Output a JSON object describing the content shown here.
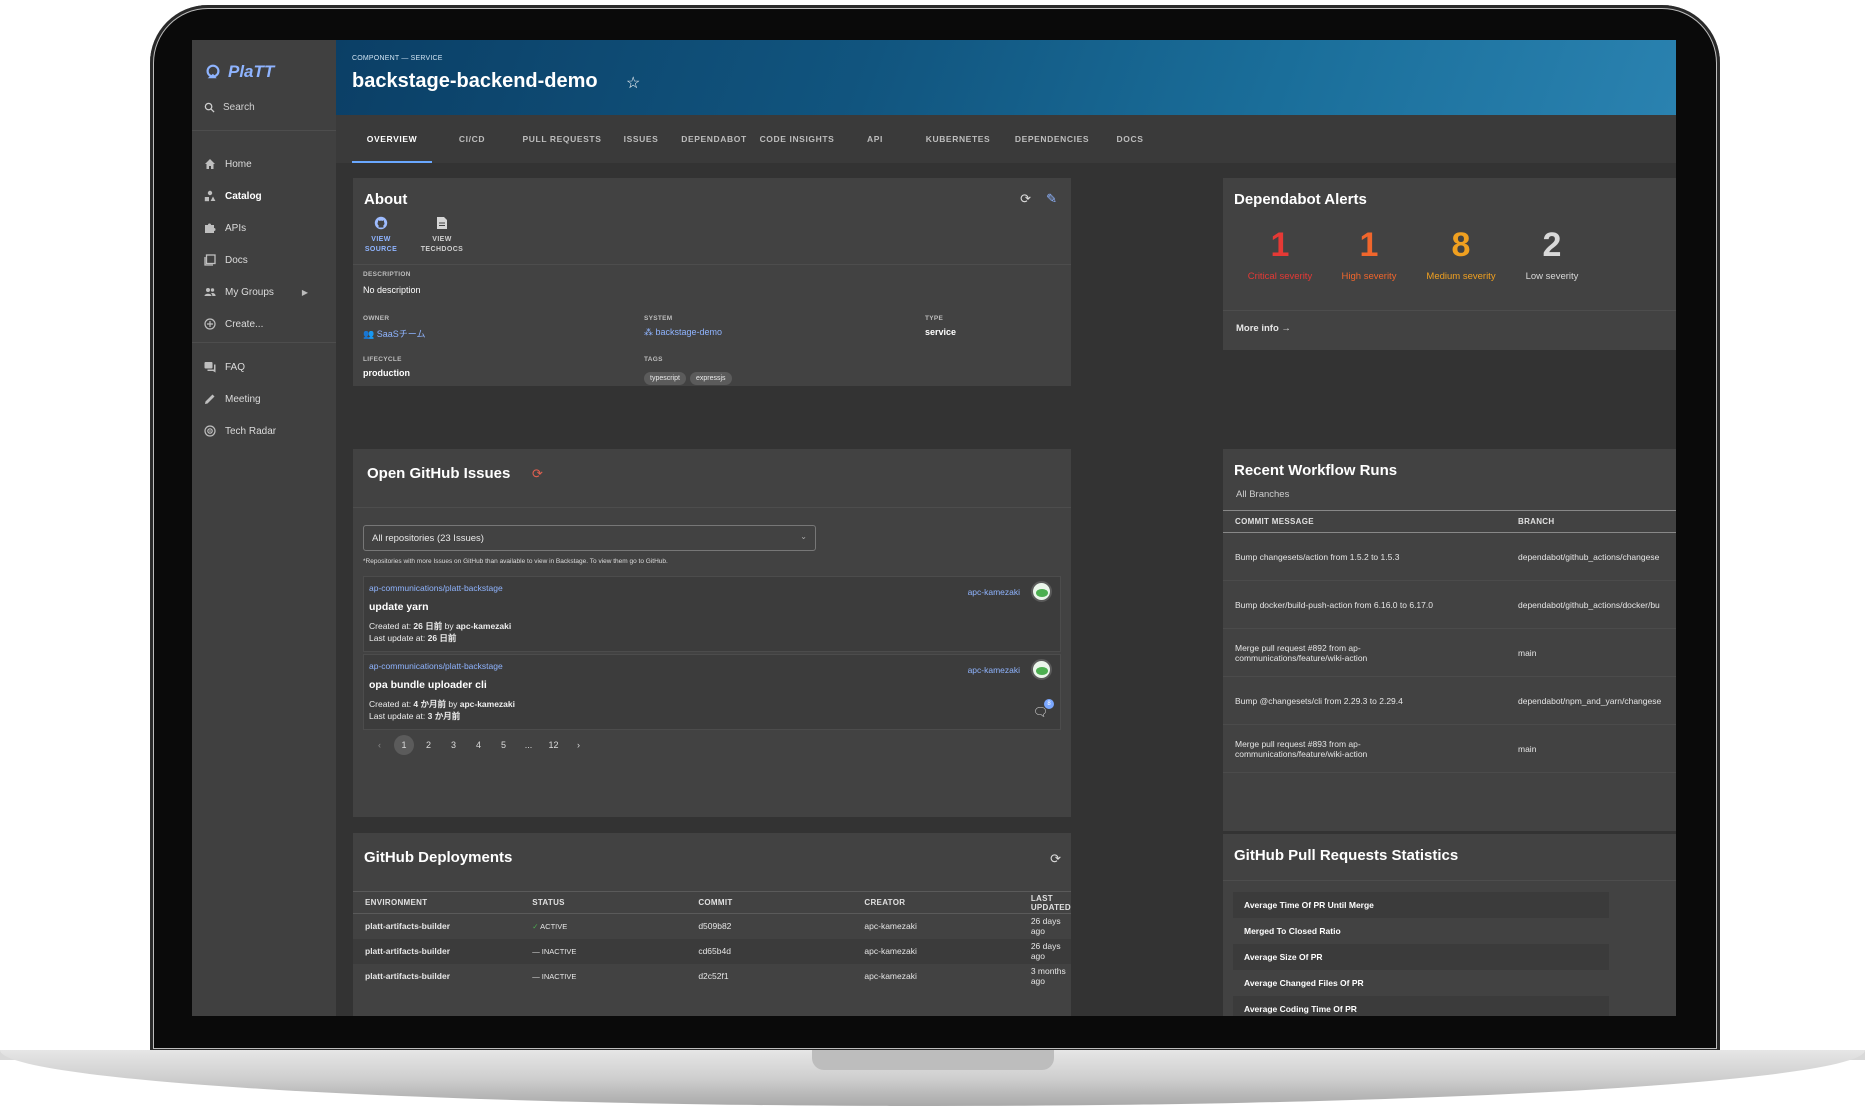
{
  "app": {
    "logo": "PlaTT"
  },
  "sidebar": {
    "search_label": "Search",
    "items": [
      {
        "label": "Home"
      },
      {
        "label": "Catalog"
      },
      {
        "label": "APIs"
      },
      {
        "label": "Docs"
      },
      {
        "label": "My Groups"
      },
      {
        "label": "Create..."
      },
      {
        "label": "FAQ"
      },
      {
        "label": "Meeting"
      },
      {
        "label": "Tech Radar"
      }
    ]
  },
  "header": {
    "kicker": "COMPONENT — SERVICE",
    "title": "backstage-backend-demo"
  },
  "tabs": [
    {
      "label": "OVERVIEW"
    },
    {
      "label": "CI/CD"
    },
    {
      "label": "PULL REQUESTS"
    },
    {
      "label": "ISSUES"
    },
    {
      "label": "DEPENDABOT"
    },
    {
      "label": "CODE INSIGHTS"
    },
    {
      "label": "API"
    },
    {
      "label": "KUBERNETES"
    },
    {
      "label": "DEPENDENCIES"
    },
    {
      "label": "DOCS"
    }
  ],
  "about": {
    "title": "About",
    "links": {
      "view": "VIEW",
      "source": "SOURCE",
      "techdocs": "TECHDOCS"
    },
    "description_label": "DESCRIPTION",
    "description": "No description",
    "owner_label": "OWNER",
    "owner": "SaaSチーム",
    "system_label": "SYSTEM",
    "system": "backstage-demo",
    "type_label": "TYPE",
    "type": "service",
    "lifecycle_label": "LIFECYCLE",
    "lifecycle": "production",
    "tags_label": "TAGS",
    "tags": [
      "typescript",
      "expressjs"
    ]
  },
  "dependabot": {
    "title": "Dependabot Alerts",
    "severities": [
      {
        "count": "1",
        "label": "Critical severity",
        "color": "#e53935"
      },
      {
        "count": "1",
        "label": "High severity",
        "color": "#f0662c"
      },
      {
        "count": "8",
        "label": "Medium severity",
        "color": "#f0a020"
      },
      {
        "count": "2",
        "label": "Low severity",
        "color": "#d8d8d8"
      }
    ],
    "more_info": "More info"
  },
  "issues": {
    "title": "Open GitHub Issues",
    "select_value": "All repositories (23 Issues)",
    "note": "*Repositories with more Issues on GitHub than available to view in Backstage. To view them go to GitHub.",
    "items": [
      {
        "repo": "ap-communications/platt-backstage",
        "title": "update yarn",
        "created_prefix": "Created at: ",
        "created": "26 日前",
        "by": " by ",
        "author": "apc-kamezaki",
        "updated_prefix": "Last update at: ",
        "updated": "26 日前",
        "user": "apc-kamezaki"
      },
      {
        "repo": "ap-communications/platt-backstage",
        "title": "opa bundle uploader cli",
        "created_prefix": "Created at: ",
        "created": "4 か月前",
        "by": " by ",
        "author": "apc-kamezaki",
        "updated_prefix": "Last update at: ",
        "updated": "3 か月前",
        "user": "apc-kamezaki",
        "comments": "8"
      }
    ],
    "pages": [
      "1",
      "2",
      "3",
      "4",
      "5",
      "...",
      "12"
    ]
  },
  "deployments": {
    "title": "GitHub Deployments",
    "columns": [
      "ENVIRONMENT",
      "STATUS",
      "COMMIT",
      "CREATOR",
      "LAST UPDATED"
    ],
    "rows": [
      {
        "env": "platt-artifacts-builder",
        "status": "ACTIVE",
        "commit": "d509b82",
        "creator": "apc-kamezaki",
        "updated": "26 days ago"
      },
      {
        "env": "platt-artifacts-builder",
        "status": "INACTIVE",
        "commit": "cd65b4d",
        "creator": "apc-kamezaki",
        "updated": "26 days ago"
      },
      {
        "env": "platt-artifacts-builder",
        "status": "INACTIVE",
        "commit": "d2c52f1",
        "creator": "apc-kamezaki",
        "updated": "3 months ago"
      }
    ]
  },
  "workflows": {
    "title": "Recent Workflow Runs",
    "subtitle": "All Branches",
    "columns": [
      "COMMIT MESSAGE",
      "BRANCH"
    ],
    "rows": [
      {
        "message": "Bump changesets/action from 1.5.2 to 1.5.3",
        "branch": "dependabot/github_actions/changese"
      },
      {
        "message": "Bump docker/build-push-action from 6.16.0 to 6.17.0",
        "branch": "dependabot/github_actions/docker/bu"
      },
      {
        "message": "Merge pull request #892 from ap-communications/feature/wiki-action",
        "branch": "main"
      },
      {
        "message": "Bump @changesets/cli from 2.29.3 to 2.29.4",
        "branch": "dependabot/npm_and_yarn/changese"
      },
      {
        "message": "Merge pull request #893 from ap-communications/feature/wiki-action",
        "branch": "main"
      }
    ]
  },
  "pr_stats": {
    "title": "GitHub Pull Requests Statistics",
    "rows": [
      "Average Time Of PR Until Merge",
      "Merged To Closed Ratio",
      "Average Size Of PR",
      "Average Changed Files Of PR",
      "Average Coding Time Of PR"
    ]
  }
}
